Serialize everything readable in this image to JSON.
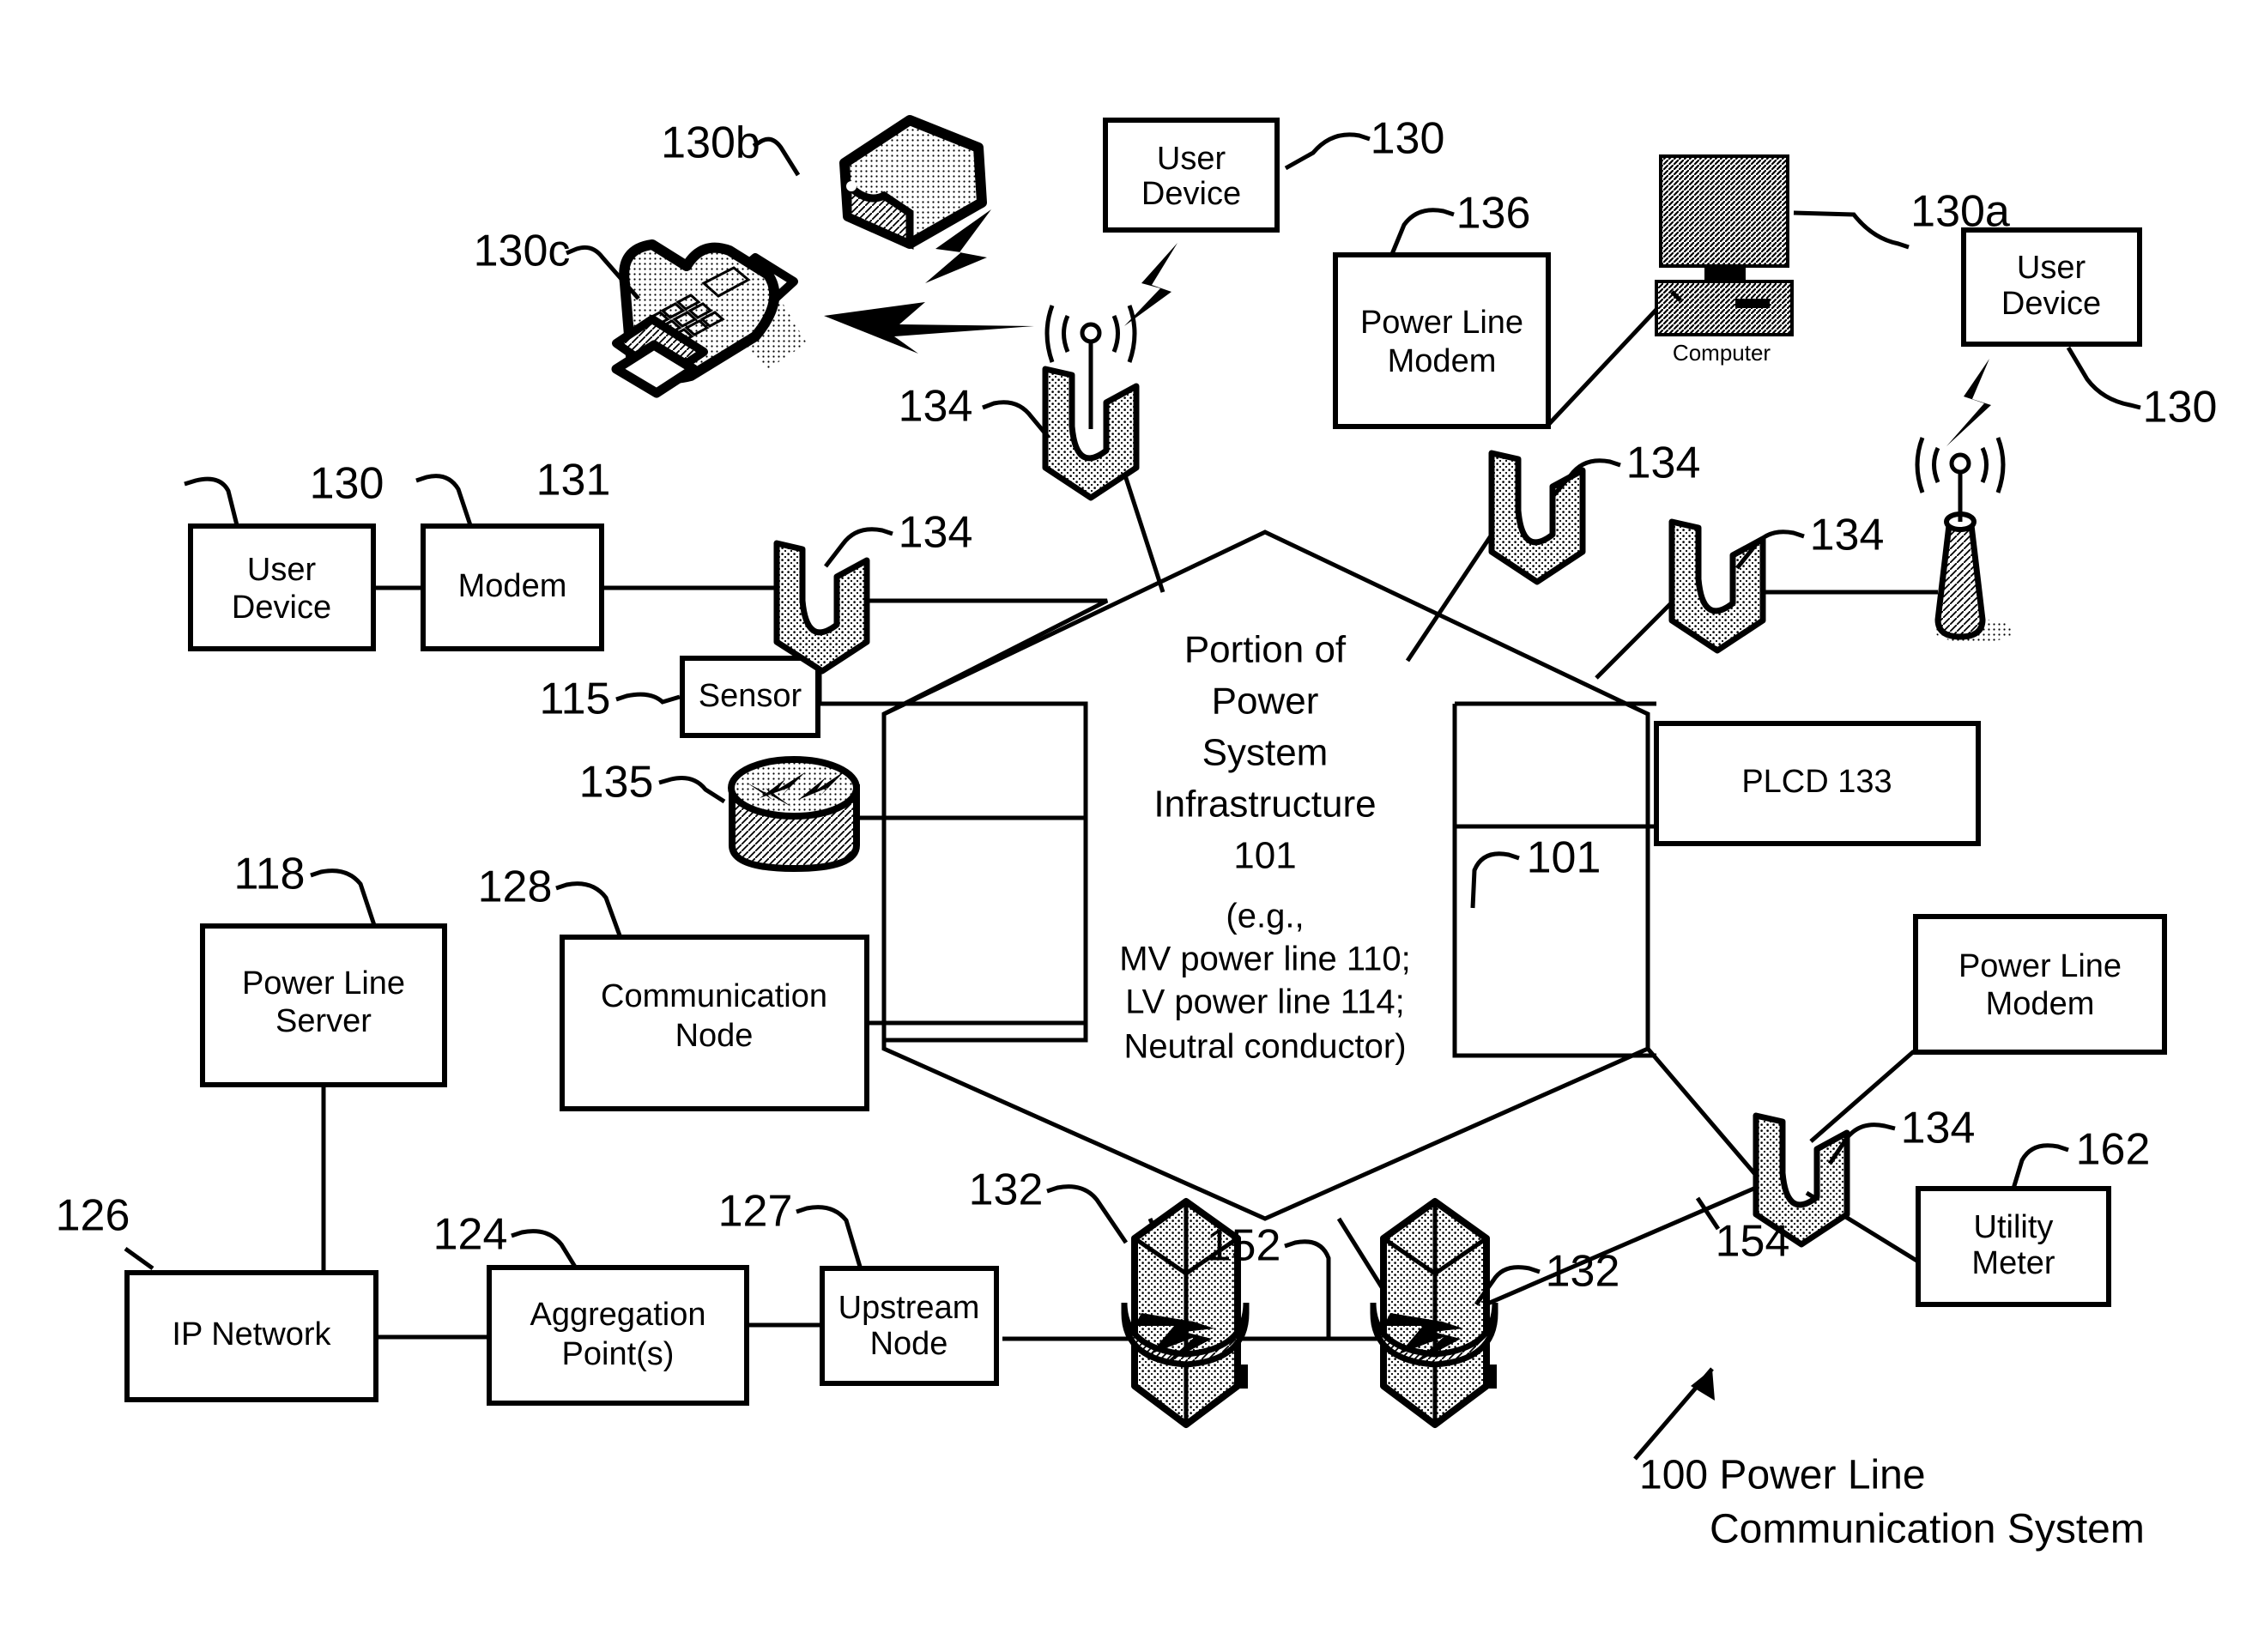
{
  "figure": {
    "caption_line1": "100 Power Line",
    "caption_line2": "Communication System"
  },
  "center": {
    "line1": "Portion of",
    "line2": "Power",
    "line3": "System",
    "line4": "Infrastructure",
    "line5": "101",
    "eg1": "(e.g.,",
    "eg2": "MV power line 110;",
    "eg3": "LV power line 114;",
    "eg4": "Neutral conductor)"
  },
  "boxes": {
    "user_device_top": {
      "line1": "User",
      "line2": "Device"
    },
    "user_device_left": {
      "line1": "User",
      "line2": "Device"
    },
    "user_device_right": {
      "line1": "User",
      "line2": "Device"
    },
    "modem_left": {
      "line1": "Modem"
    },
    "sensor": {
      "line1": "Sensor"
    },
    "power_line_modem_top": {
      "line1": "Power Line",
      "line2": "Modem"
    },
    "power_line_modem_right": {
      "line1": "Power Line",
      "line2": "Modem"
    },
    "plcd": {
      "line1": "PLCD 133"
    },
    "power_line_server": {
      "line1": "Power Line",
      "line2": "Server"
    },
    "communication_node": {
      "line1": "Communication",
      "line2": "Node"
    },
    "ip_network": {
      "line1": "IP Network"
    },
    "aggregation_point": {
      "line1": "Aggregation",
      "line2": "Point(s)"
    },
    "upstream_node": {
      "line1": "Upstream",
      "line2": "Node"
    },
    "utility_meter": {
      "line1": "Utility",
      "line2": "Meter"
    }
  },
  "labels": {
    "computer": "Computer"
  },
  "refs": {
    "r130b": "130b",
    "r130c": "130c",
    "r130_top": "130",
    "r136": "136",
    "r130a": "130a",
    "r130_right": "130",
    "r134_center": "134",
    "r134_topright": "134",
    "r134_right": "134",
    "r130_left": "130",
    "r131": "131",
    "r134_left": "134",
    "r115": "115",
    "r135": "135",
    "r101_right": "101",
    "r118": "118",
    "r128": "128",
    "r126": "126",
    "r124": "124",
    "r127": "127",
    "r132_left": "132",
    "r152": "152",
    "r132_right": "132",
    "r134_br": "134",
    "r162": "162",
    "r154": "154"
  },
  "colors": {
    "stroke": "#000000",
    "background": "#ffffff",
    "fill": "#ffffff"
  }
}
